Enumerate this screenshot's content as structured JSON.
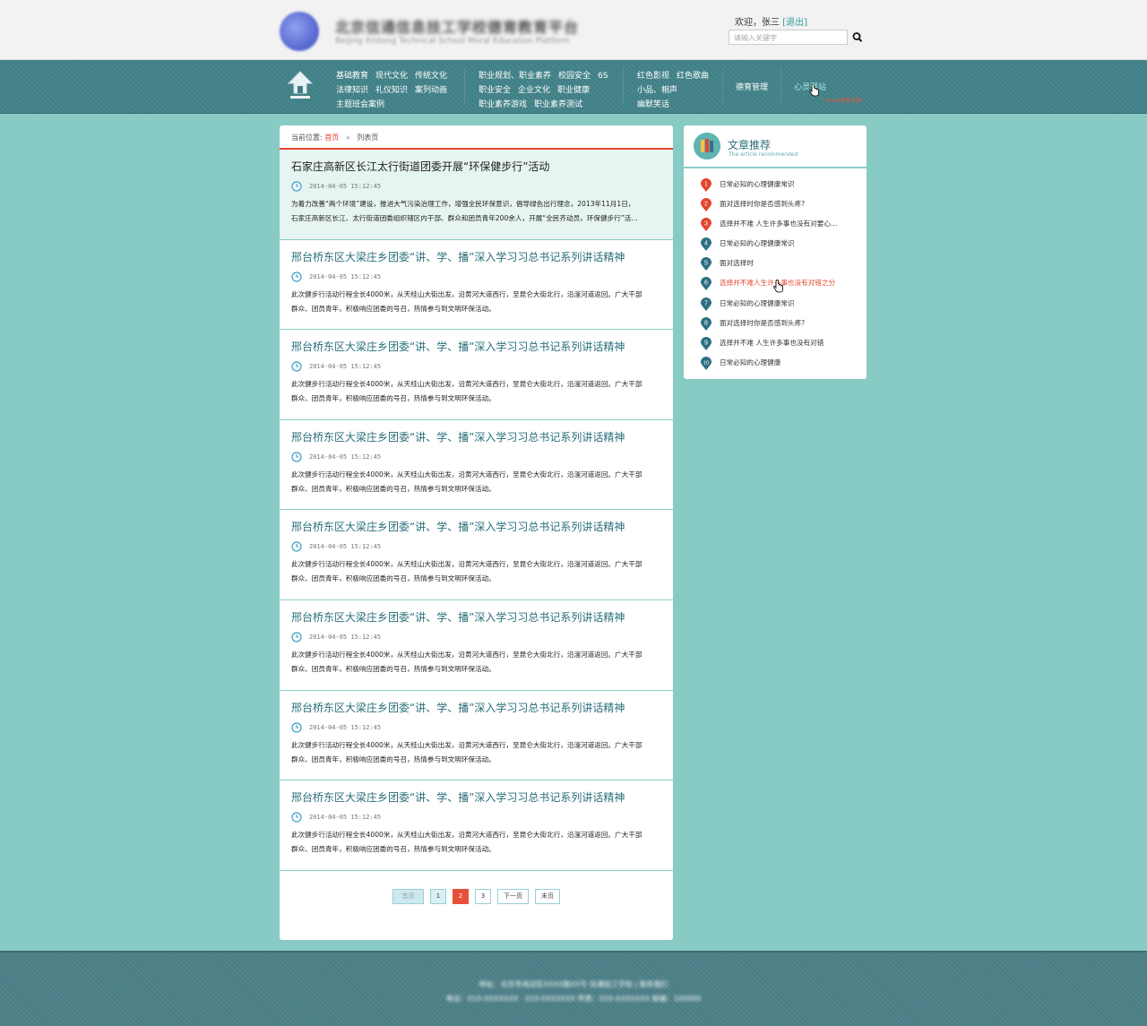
{
  "header": {
    "site_title": "北京信通信息技工学校德育教育平台",
    "site_subtitle": "Beijing Xintong Technical School Moral Education Platform",
    "welcome": "欢迎，张三",
    "logout": "[退出]",
    "search_placeholder": "请输入关键字"
  },
  "nav": {
    "group1": [
      [
        "基础教育",
        "现代文化",
        "传统文化"
      ],
      [
        "法律知识",
        "礼仪知识",
        "案列动画"
      ],
      [
        "主题班会案例"
      ]
    ],
    "group2": [
      [
        "职业规划、职业素养",
        "校园安全",
        "6S"
      ],
      [
        "职业安全",
        "企业文化",
        "职业健康"
      ],
      [
        "职业素养游戏",
        "职业素养测试"
      ]
    ],
    "group3": [
      [
        "红色影视",
        "红色歌曲"
      ],
      [
        "小品、相声"
      ],
      [
        "幽默笑话"
      ]
    ],
    "moral": "德育管理",
    "psych": "心灵驿站",
    "hover_note": "hover颜色加深"
  },
  "breadcrumb": {
    "label": "当前位置:",
    "home": "首页",
    "sep": "»",
    "current": "列表页"
  },
  "articles": [
    {
      "title": "石家庄高新区长江太行街道团委开展“环保健步行”活动",
      "time": "2014-04-05 15:12:45",
      "line1": "为着力改善“两个环境”建设，推进大气污染治理工作，增强全民环保意识，倡导绿色出行理念，2013年11月1日，",
      "line2": "石家庄高新区长江、太行街道团委组织辖区内干部、群众和团员青年200余人，开展“全民齐动员，环保健步行”活…"
    },
    {
      "title": "邢台桥东区大梁庄乡团委“讲、学、播”深入学习习总书记系列讲话精神",
      "time": "2014-04-05 15:12:45",
      "line1": "此次健步行活动行程全长4000米，从天桂山大街出发，沿黄河大道西行，至昆仑大街北行，沿滏河道返回。广大干部",
      "line2": "群众、团员青年，积极响应团委的号召，热情参与到文明环保活动。"
    },
    {
      "title": "邢台桥东区大梁庄乡团委“讲、学、播”深入学习习总书记系列讲话精神",
      "time": "2014-04-05 15:12:45",
      "line1": "此次健步行活动行程全长4000米，从天桂山大街出发，沿黄河大道西行，至昆仑大街北行，沿滏河道返回。广大干部",
      "line2": "群众、团员青年，积极响应团委的号召，热情参与到文明环保活动。"
    },
    {
      "title": "邢台桥东区大梁庄乡团委“讲、学、播”深入学习习总书记系列讲话精神",
      "time": "2014-04-05 15:12:45",
      "line1": "此次健步行活动行程全长4000米，从天桂山大街出发，沿黄河大道西行，至昆仑大街北行，沿滏河道返回。广大干部",
      "line2": "群众、团员青年，积极响应团委的号召，热情参与到文明环保活动。"
    },
    {
      "title": "邢台桥东区大梁庄乡团委“讲、学、播”深入学习习总书记系列讲话精神",
      "time": "2014-04-05 15:12:45",
      "line1": "此次健步行活动行程全长4000米，从天桂山大街出发，沿黄河大道西行，至昆仑大街北行，沿滏河道返回。广大干部",
      "line2": "群众、团员青年，积极响应团委的号召，热情参与到文明环保活动。"
    },
    {
      "title": "邢台桥东区大梁庄乡团委“讲、学、播”深入学习习总书记系列讲话精神",
      "time": "2014-04-05 15:12:45",
      "line1": "此次健步行活动行程全长4000米，从天桂山大街出发，沿黄河大道西行，至昆仑大街北行，沿滏河道返回。广大干部",
      "line2": "群众、团员青年，积极响应团委的号召，热情参与到文明环保活动。"
    },
    {
      "title": "邢台桥东区大梁庄乡团委“讲、学、播”深入学习习总书记系列讲话精神",
      "time": "2014-04-05 15:12:45",
      "line1": "此次健步行活动行程全长4000米，从天桂山大街出发，沿黄河大道西行，至昆仑大街北行，沿滏河道返回。广大干部",
      "line2": "群众、团员青年，积极响应团委的号召，热情参与到文明环保活动。"
    },
    {
      "title": "邢台桥东区大梁庄乡团委“讲、学、播”深入学习习总书记系列讲话精神",
      "time": "2014-04-05 15:12:45",
      "line1": "此次健步行活动行程全长4000米，从天桂山大街出发，沿黄河大道西行，至昆仑大街北行，沿滏河道返回。广大干部",
      "line2": "群众、团员青年，积极响应团委的号召，热情参与到文明环保活动。"
    }
  ],
  "pager": {
    "first": "首页",
    "pages": [
      "1",
      "2",
      "3"
    ],
    "current_page": "2",
    "next": "下一页",
    "last": "末页"
  },
  "sidebar": {
    "title": "文章推荐",
    "subtitle": "The article recommended",
    "items": [
      {
        "num": "1",
        "text": "日常必知的心理健康常识"
      },
      {
        "num": "2",
        "text": "面对选择时你是否感到头疼?"
      },
      {
        "num": "3",
        "text": "选择并不难 人生许多事也没有对要心…"
      },
      {
        "num": "4",
        "text": "日常必知的心理健康常识"
      },
      {
        "num": "5",
        "text": "面对选择时"
      },
      {
        "num": "6",
        "text": "选择并不难人生许多事也没有对错之分"
      },
      {
        "num": "7",
        "text": "日常必知的心理健康常识"
      },
      {
        "num": "8",
        "text": "面对选择时你是否感到头疼?"
      },
      {
        "num": "9",
        "text": "选择并不难 人生许多事也没有对错"
      },
      {
        "num": "10",
        "text": "日常必知的心理健康"
      }
    ]
  },
  "footer": {
    "line1": "地址：北京市海淀区XXXX路XX号 信通技工学校 | 联系我们",
    "line2": "电话：010-XXXXXXX · 010-XXXXXXX 传真：010-XXXXXXX 邮编：100000"
  },
  "colors": {
    "background": "#87cbc4",
    "nav": "#3f7f86",
    "accent_red": "#e2452e",
    "title_teal": "#2a6f7a"
  }
}
